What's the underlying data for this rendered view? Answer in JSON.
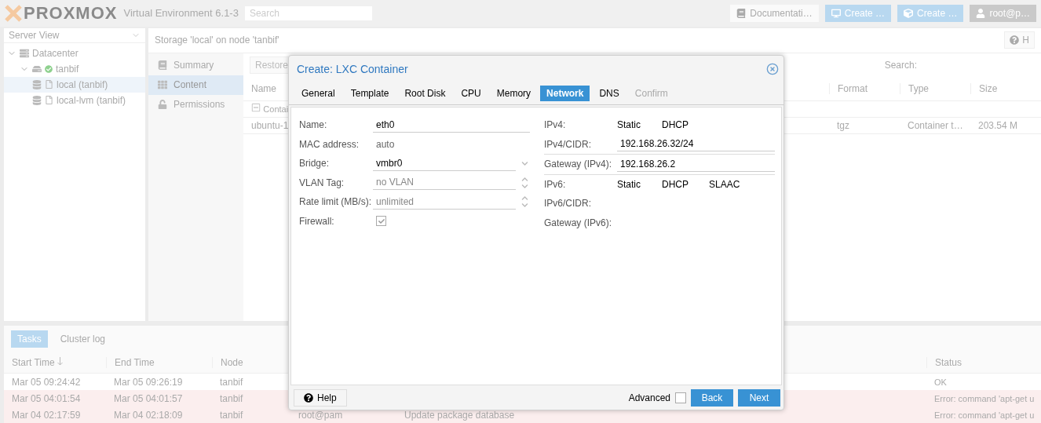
{
  "header": {
    "logo": "PROXMOX",
    "version": "Virtual Environment 6.1-3",
    "search": {
      "placeholder": "Search"
    },
    "buttons": [
      {
        "label": "Documentati…",
        "kind": "doc"
      },
      {
        "label": "Create …",
        "kind": "vm"
      },
      {
        "label": "Create …",
        "kind": "ct"
      },
      {
        "label": "root@p…",
        "kind": "user"
      }
    ]
  },
  "tree": {
    "view": "Server View",
    "items": [
      {
        "label": "Datacenter",
        "kind": "datacenter",
        "expanded": true,
        "selected": false,
        "children": [
          {
            "label": "tanbif",
            "kind": "node",
            "expanded": true,
            "selected": false,
            "children": [
              {
                "label": "local (tanbif)",
                "kind": "storage",
                "selected": true
              },
              {
                "label": "local-lvm (tanbif)",
                "kind": "storage",
                "selected": false
              }
            ]
          }
        ]
      }
    ]
  },
  "content": {
    "title": "Storage 'local' on node 'tanbif'",
    "help": "H",
    "nav": [
      {
        "label": "Summary",
        "kind": "summary",
        "selected": false
      },
      {
        "label": "Content",
        "kind": "content",
        "selected": true
      },
      {
        "label": "Permissions",
        "kind": "permissions",
        "selected": false
      }
    ],
    "toolbar": {
      "button": "Restore",
      "search_label": "Search:"
    },
    "columns": [
      "Name",
      "Format",
      "Type",
      "Size"
    ],
    "group": "Contai",
    "rows": [
      {
        "name": "ubuntu-1",
        "format": "tgz",
        "type": "Container t…",
        "size": "203.54 M"
      }
    ]
  },
  "dialog": {
    "title": "Create: LXC Container",
    "tabs": [
      {
        "label": "General",
        "selected": false,
        "disabled": false
      },
      {
        "label": "Template",
        "selected": false,
        "disabled": false
      },
      {
        "label": "Root Disk",
        "selected": false,
        "disabled": false
      },
      {
        "label": "CPU",
        "selected": false,
        "disabled": false
      },
      {
        "label": "Memory",
        "selected": false,
        "disabled": false
      },
      {
        "label": "Network",
        "selected": true,
        "disabled": false
      },
      {
        "label": "DNS",
        "selected": false,
        "disabled": false
      },
      {
        "label": "Confirm",
        "selected": false,
        "disabled": true
      }
    ],
    "left": [
      {
        "label": "Name:",
        "kind": "text",
        "value": "eth0"
      },
      {
        "label": "MAC address:",
        "kind": "display",
        "value": "auto"
      },
      {
        "label": "Bridge:",
        "kind": "combo",
        "value": "vmbr0"
      },
      {
        "label": "VLAN Tag:",
        "kind": "spinner",
        "placeholder": "no VLAN"
      },
      {
        "label": "Rate limit (MB/s):",
        "kind": "spinner",
        "placeholder": "unlimited"
      },
      {
        "label": "Firewall:",
        "kind": "checkbox",
        "checked": true
      }
    ],
    "right": [
      {
        "label": "IPv4:",
        "kind": "radios",
        "options": [
          "Static",
          "DHCP"
        ]
      },
      {
        "label": "IPv4/CIDR:",
        "kind": "text",
        "value": "192.168.26.32/24"
      },
      {
        "label": "Gateway (IPv4):",
        "kind": "text",
        "value": "192.168.26.2"
      },
      {
        "label": "IPv6:",
        "kind": "radios",
        "options": [
          "Static",
          "DHCP",
          "SLAAC"
        ]
      },
      {
        "label": "IPv6/CIDR:",
        "kind": "empty"
      },
      {
        "label": "Gateway (IPv6):",
        "kind": "empty"
      }
    ],
    "help": "Help",
    "advanced": {
      "label": "Advanced",
      "checked": false
    },
    "back": "Back",
    "next": "Next"
  },
  "tasks": {
    "tabs": [
      {
        "label": "Tasks",
        "selected": true
      },
      {
        "label": "Cluster log",
        "selected": false
      }
    ],
    "columns": [
      "Start Time",
      "End Time",
      "Node",
      "Status"
    ],
    "rows": [
      {
        "start": "Mar 05 09:24:42",
        "end": "Mar 05 09:26:19",
        "node": "tanbif",
        "status": "OK",
        "error": false
      },
      {
        "start": "Mar 05 04:01:54",
        "end": "Mar 05 04:01:57",
        "node": "tanbif",
        "status": "Error: command 'apt-get u",
        "error": true
      },
      {
        "start": "Mar 04 02:17:59",
        "end": "Mar 04 02:18:09",
        "node": "tanbif",
        "user": "root@pam",
        "description": "Update package database",
        "status": "Error: command 'apt-get u",
        "error": true
      }
    ]
  }
}
